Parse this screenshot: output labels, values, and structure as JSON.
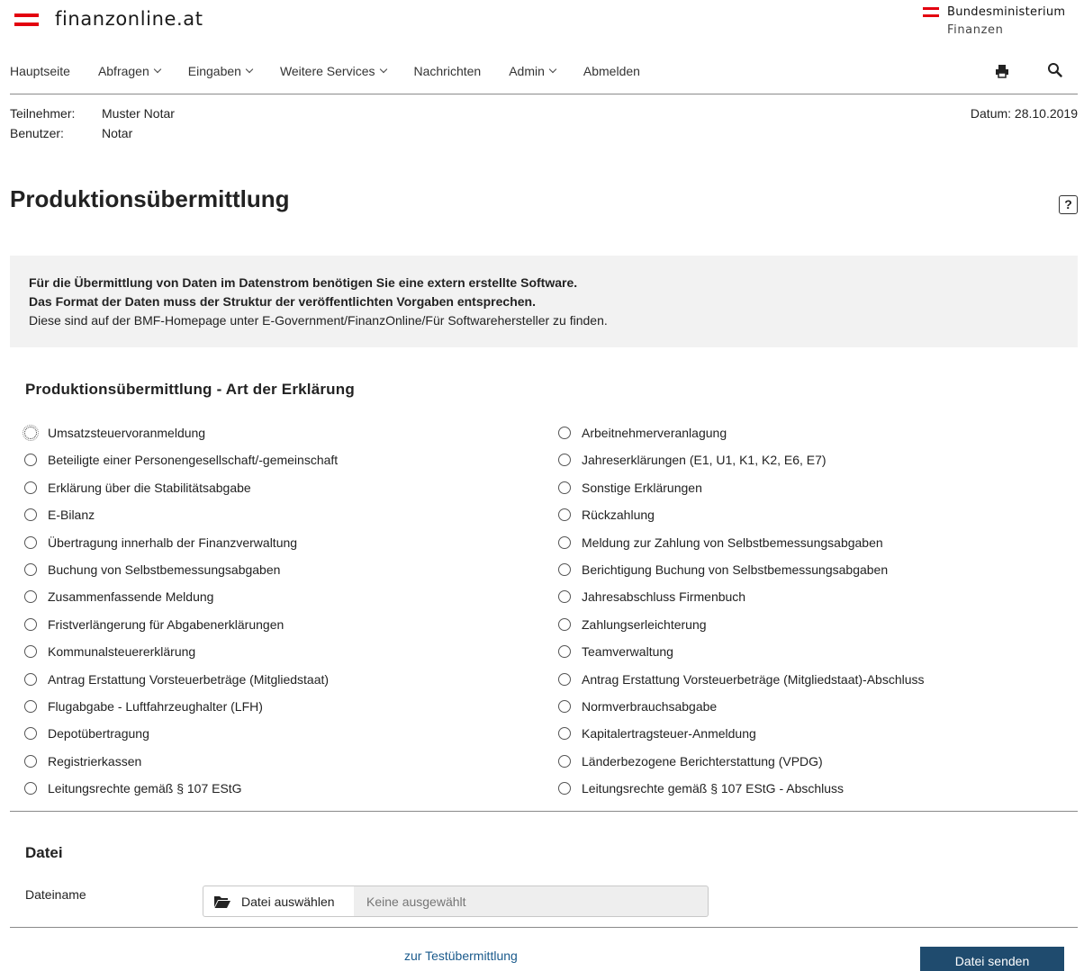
{
  "header": {
    "logo_text": "finanzonline.at",
    "ministry_line1": "Bundesministerium",
    "ministry_line2": "Finanzen"
  },
  "nav": {
    "items": [
      {
        "label": "Hauptseite",
        "dropdown": false
      },
      {
        "label": "Abfragen",
        "dropdown": true
      },
      {
        "label": "Eingaben",
        "dropdown": true
      },
      {
        "label": "Weitere Services",
        "dropdown": true
      },
      {
        "label": "Nachrichten",
        "dropdown": false
      },
      {
        "label": "Admin",
        "dropdown": true
      },
      {
        "label": "Abmelden",
        "dropdown": false
      }
    ],
    "icons": [
      "print-icon",
      "search-icon"
    ]
  },
  "user": {
    "participant_label": "Teilnehmer:",
    "participant_value": "Muster Notar",
    "user_label": "Benutzer:",
    "user_value": "Notar",
    "date_text": "Datum: 28.10.2019"
  },
  "page": {
    "title": "Produktionsübermittlung",
    "help_label": "?"
  },
  "notice": {
    "line1": "Für die Übermittlung von Daten im Datenstrom benötigen Sie eine extern erstellte Software.",
    "line2": "Das Format der Daten muss der Struktur der veröffentlichten Vorgaben entsprechen.",
    "line3": "Diese sind auf der BMF-Homepage unter E-Government/FinanzOnline/Für Softwarehersteller zu finden."
  },
  "declaration_type": {
    "heading": "Produktionsübermittlung - Art der Erklärung",
    "left": [
      "Umsatzsteuervoranmeldung",
      "Beteiligte einer Personengesellschaft/-gemeinschaft",
      "Erklärung über die Stabilitätsabgabe",
      "E-Bilanz",
      "Übertragung innerhalb der Finanzverwaltung",
      "Buchung von Selbstbemessungsabgaben",
      "Zusammenfassende Meldung",
      "Fristverlängerung für Abgabenerklärungen",
      "Kommunalsteuererklärung",
      "Antrag Erstattung Vorsteuerbeträge (Mitgliedstaat)",
      "Flugabgabe - Luftfahrzeughalter (LFH)",
      "Depotübertragung",
      "Registrierkassen",
      "Leitungsrechte gemäß § 107 EStG"
    ],
    "right": [
      "Arbeitnehmerveranlagung",
      "Jahreserklärungen (E1, U1, K1, K2, E6, E7)",
      "Sonstige Erklärungen",
      "Rückzahlung",
      "Meldung zur Zahlung von Selbstbemessungsabgaben",
      "Berichtigung Buchung von Selbstbemessungsabgaben",
      "Jahresabschluss Firmenbuch",
      "Zahlungserleichterung",
      "Teamverwaltung",
      "Antrag Erstattung Vorsteuerbeträge (Mitgliedstaat)-Abschluss",
      "Normverbrauchsabgabe",
      "Kapitalertragsteuer-Anmeldung",
      "Länderbezogene Berichterstattung (VPDG)",
      "Leitungsrechte gemäß § 107 EStG - Abschluss"
    ],
    "focused_option": "Umsatzsteuervoranmeldung"
  },
  "file": {
    "heading": "Datei",
    "label": "Dateiname",
    "button_label": "Datei auswählen",
    "placeholder": "Keine ausgewählt"
  },
  "footer": {
    "test_link": "zur Testübermittlung",
    "send_label": "Datei senden"
  }
}
